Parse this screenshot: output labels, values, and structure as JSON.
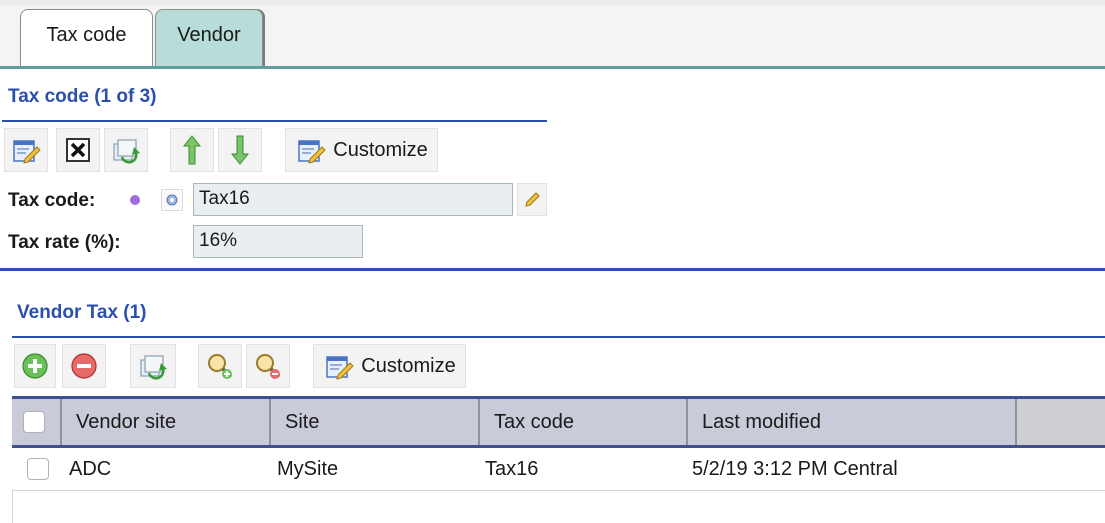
{
  "tabs": [
    {
      "label": "Tax code"
    },
    {
      "label": "Vendor"
    }
  ],
  "tax_section": {
    "title": "Tax code (1 of 3)",
    "toolbar": {
      "icons": [
        "edit-form-icon",
        "delete-icon",
        "refresh-icon",
        "arrow-up-icon",
        "arrow-down-icon"
      ],
      "customize_label": "Customize"
    },
    "fields": {
      "tax_code_label": "Tax code:",
      "tax_code_value": "Tax16",
      "tax_rate_label": "Tax rate (%):",
      "tax_rate_value": "16%"
    }
  },
  "vendor_section": {
    "title": "Vendor Tax (1)",
    "toolbar": {
      "icons": [
        "add-icon",
        "remove-icon",
        "refresh-icon",
        "zoom-in-icon",
        "zoom-out-icon"
      ],
      "customize_label": "Customize"
    },
    "grid": {
      "columns": [
        "Vendor site",
        "Site",
        "Tax code",
        "Last modified"
      ],
      "rows": [
        {
          "vendor_site": "ADC",
          "site": "MySite",
          "tax_code": "Tax16",
          "last_modified": "5/2/19 3:12 PM Central"
        }
      ]
    }
  },
  "colors": {
    "accent_blue": "#2a4fae",
    "active_tab": "#b8dcd8",
    "header_bg": "#c9cad8",
    "required_dot": "#a36be0"
  }
}
